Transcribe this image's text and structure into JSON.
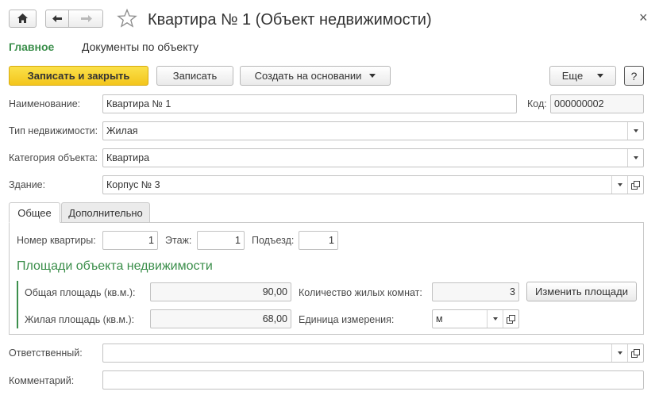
{
  "window": {
    "title": "Квартира № 1 (Объект недвижимости)",
    "close_glyph": "×"
  },
  "nav": {
    "home_icon": "home-icon",
    "back_icon": "arrow-left-icon",
    "forward_icon": "arrow-right-icon",
    "favorite_icon": "star-icon"
  },
  "top_tabs": [
    {
      "label": "Главное",
      "active": true
    },
    {
      "label": "Документы по объекту",
      "active": false
    }
  ],
  "toolbar": {
    "save_close_label": "Записать и закрыть",
    "save_label": "Записать",
    "create_based_label": "Создать на основании",
    "more_label": "Еще",
    "help_label": "?"
  },
  "form": {
    "name_label": "Наименование:",
    "name_value": "Квартира № 1",
    "code_label": "Код:",
    "code_value": "000000002",
    "type_label": "Тип недвижимости:",
    "type_value": "Жилая",
    "category_label": "Категория объекта:",
    "category_value": "Квартира",
    "building_label": "Здание:",
    "building_value": "Корпус № 3"
  },
  "panel_tabs": [
    {
      "label": "Общее",
      "active": true
    },
    {
      "label": "Дополнительно",
      "active": false
    }
  ],
  "general": {
    "apartment_label": "Номер квартиры:",
    "apartment_value": "1",
    "floor_label": "Этаж:",
    "floor_value": "1",
    "entrance_label": "Подъезд:",
    "entrance_value": "1",
    "areas_title": "Площади объекта недвижимости",
    "total_area_label": "Общая площадь (кв.м.):",
    "total_area_value": "90,00",
    "living_area_label": "Жилая площадь (кв.м.):",
    "living_area_value": "68,00",
    "rooms_label": "Количество жилых комнат:",
    "rooms_value": "3",
    "change_areas_label": "Изменить площади",
    "unit_label": "Единица измерения:",
    "unit_value": "м"
  },
  "bottom": {
    "responsible_label": "Ответственный:",
    "responsible_value": "",
    "comment_label": "Комментарий:",
    "comment_value": ""
  },
  "colors": {
    "primary_button": "#f5c82a",
    "accent_green": "#3a8e4a"
  }
}
